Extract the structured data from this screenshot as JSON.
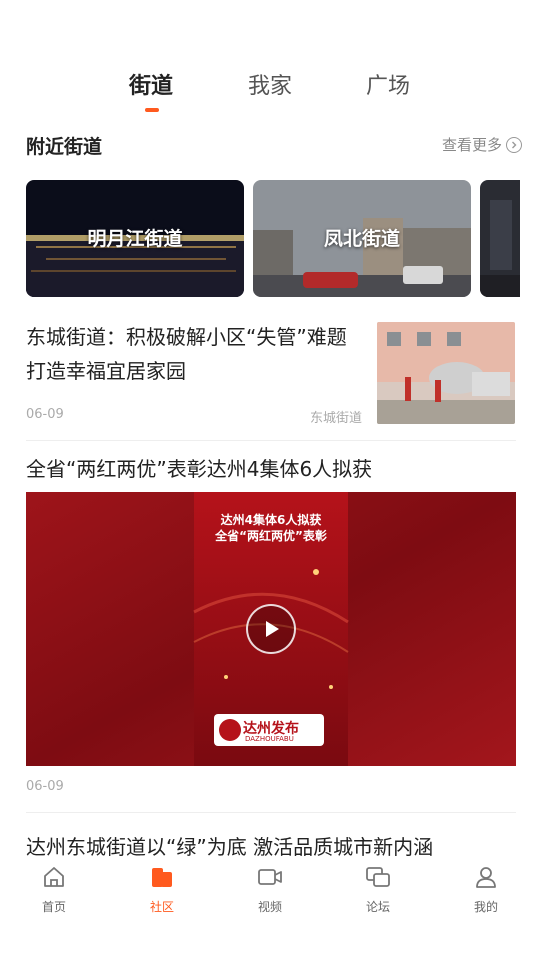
{
  "top_tabs": [
    {
      "label": "街道",
      "active": true
    },
    {
      "label": "我家",
      "active": false
    },
    {
      "label": "广场",
      "active": false
    }
  ],
  "nearby": {
    "title": "附近街道",
    "more_label": "查看更多",
    "cards": [
      {
        "label": "明月江街道"
      },
      {
        "label": "凤北街道"
      },
      {
        "label": ""
      }
    ]
  },
  "articles": [
    {
      "title": "东城街道：积极破解小区“失管”难题 打造幸福宜居家园",
      "date": "06-09",
      "source": "东城街道"
    },
    {
      "title": "全省“两红两优”表彰达州4集体6人拟获",
      "date": "06-09",
      "video_caption_line1": "达州4集体6人拟获",
      "video_caption_line2": "全省“两红两优”表彰",
      "video_logo_text": "达州发布",
      "video_logo_sub": "DAZHOUFABU"
    },
    {
      "title": "达州东城街道以“绿”为底 激活品质城市新内涵"
    }
  ],
  "bottom_nav": [
    {
      "label": "首页",
      "icon": "home-icon",
      "active": false
    },
    {
      "label": "社区",
      "icon": "community-icon",
      "active": true
    },
    {
      "label": "视频",
      "icon": "video-icon",
      "active": false
    },
    {
      "label": "论坛",
      "icon": "forum-icon",
      "active": false
    },
    {
      "label": "我的",
      "icon": "profile-icon",
      "active": false
    }
  ],
  "colors": {
    "accent": "#ff5a1f",
    "video_bg": "#8b0f14"
  }
}
